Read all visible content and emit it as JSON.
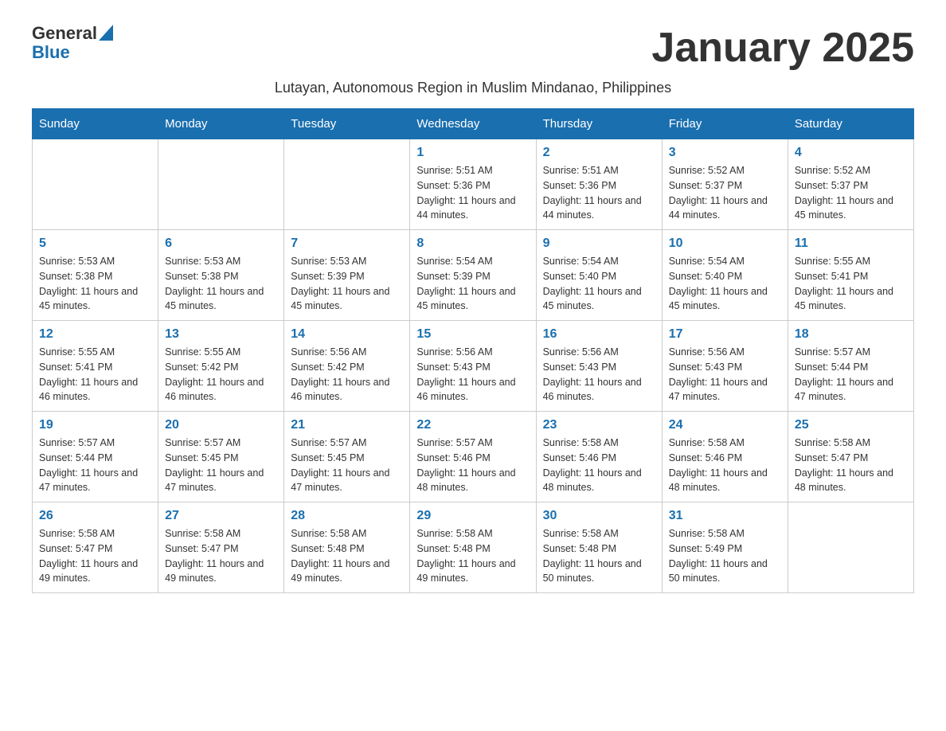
{
  "header": {
    "logo_text_general": "General",
    "logo_text_blue": "Blue",
    "month_title": "January 2025",
    "subtitle": "Lutayan, Autonomous Region in Muslim Mindanao, Philippines"
  },
  "weekdays": [
    "Sunday",
    "Monday",
    "Tuesday",
    "Wednesday",
    "Thursday",
    "Friday",
    "Saturday"
  ],
  "weeks": [
    [
      {
        "day": "",
        "info": ""
      },
      {
        "day": "",
        "info": ""
      },
      {
        "day": "",
        "info": ""
      },
      {
        "day": "1",
        "info": "Sunrise: 5:51 AM\nSunset: 5:36 PM\nDaylight: 11 hours and 44 minutes."
      },
      {
        "day": "2",
        "info": "Sunrise: 5:51 AM\nSunset: 5:36 PM\nDaylight: 11 hours and 44 minutes."
      },
      {
        "day": "3",
        "info": "Sunrise: 5:52 AM\nSunset: 5:37 PM\nDaylight: 11 hours and 44 minutes."
      },
      {
        "day": "4",
        "info": "Sunrise: 5:52 AM\nSunset: 5:37 PM\nDaylight: 11 hours and 45 minutes."
      }
    ],
    [
      {
        "day": "5",
        "info": "Sunrise: 5:53 AM\nSunset: 5:38 PM\nDaylight: 11 hours and 45 minutes."
      },
      {
        "day": "6",
        "info": "Sunrise: 5:53 AM\nSunset: 5:38 PM\nDaylight: 11 hours and 45 minutes."
      },
      {
        "day": "7",
        "info": "Sunrise: 5:53 AM\nSunset: 5:39 PM\nDaylight: 11 hours and 45 minutes."
      },
      {
        "day": "8",
        "info": "Sunrise: 5:54 AM\nSunset: 5:39 PM\nDaylight: 11 hours and 45 minutes."
      },
      {
        "day": "9",
        "info": "Sunrise: 5:54 AM\nSunset: 5:40 PM\nDaylight: 11 hours and 45 minutes."
      },
      {
        "day": "10",
        "info": "Sunrise: 5:54 AM\nSunset: 5:40 PM\nDaylight: 11 hours and 45 minutes."
      },
      {
        "day": "11",
        "info": "Sunrise: 5:55 AM\nSunset: 5:41 PM\nDaylight: 11 hours and 45 minutes."
      }
    ],
    [
      {
        "day": "12",
        "info": "Sunrise: 5:55 AM\nSunset: 5:41 PM\nDaylight: 11 hours and 46 minutes."
      },
      {
        "day": "13",
        "info": "Sunrise: 5:55 AM\nSunset: 5:42 PM\nDaylight: 11 hours and 46 minutes."
      },
      {
        "day": "14",
        "info": "Sunrise: 5:56 AM\nSunset: 5:42 PM\nDaylight: 11 hours and 46 minutes."
      },
      {
        "day": "15",
        "info": "Sunrise: 5:56 AM\nSunset: 5:43 PM\nDaylight: 11 hours and 46 minutes."
      },
      {
        "day": "16",
        "info": "Sunrise: 5:56 AM\nSunset: 5:43 PM\nDaylight: 11 hours and 46 minutes."
      },
      {
        "day": "17",
        "info": "Sunrise: 5:56 AM\nSunset: 5:43 PM\nDaylight: 11 hours and 47 minutes."
      },
      {
        "day": "18",
        "info": "Sunrise: 5:57 AM\nSunset: 5:44 PM\nDaylight: 11 hours and 47 minutes."
      }
    ],
    [
      {
        "day": "19",
        "info": "Sunrise: 5:57 AM\nSunset: 5:44 PM\nDaylight: 11 hours and 47 minutes."
      },
      {
        "day": "20",
        "info": "Sunrise: 5:57 AM\nSunset: 5:45 PM\nDaylight: 11 hours and 47 minutes."
      },
      {
        "day": "21",
        "info": "Sunrise: 5:57 AM\nSunset: 5:45 PM\nDaylight: 11 hours and 47 minutes."
      },
      {
        "day": "22",
        "info": "Sunrise: 5:57 AM\nSunset: 5:46 PM\nDaylight: 11 hours and 48 minutes."
      },
      {
        "day": "23",
        "info": "Sunrise: 5:58 AM\nSunset: 5:46 PM\nDaylight: 11 hours and 48 minutes."
      },
      {
        "day": "24",
        "info": "Sunrise: 5:58 AM\nSunset: 5:46 PM\nDaylight: 11 hours and 48 minutes."
      },
      {
        "day": "25",
        "info": "Sunrise: 5:58 AM\nSunset: 5:47 PM\nDaylight: 11 hours and 48 minutes."
      }
    ],
    [
      {
        "day": "26",
        "info": "Sunrise: 5:58 AM\nSunset: 5:47 PM\nDaylight: 11 hours and 49 minutes."
      },
      {
        "day": "27",
        "info": "Sunrise: 5:58 AM\nSunset: 5:47 PM\nDaylight: 11 hours and 49 minutes."
      },
      {
        "day": "28",
        "info": "Sunrise: 5:58 AM\nSunset: 5:48 PM\nDaylight: 11 hours and 49 minutes."
      },
      {
        "day": "29",
        "info": "Sunrise: 5:58 AM\nSunset: 5:48 PM\nDaylight: 11 hours and 49 minutes."
      },
      {
        "day": "30",
        "info": "Sunrise: 5:58 AM\nSunset: 5:48 PM\nDaylight: 11 hours and 50 minutes."
      },
      {
        "day": "31",
        "info": "Sunrise: 5:58 AM\nSunset: 5:49 PM\nDaylight: 11 hours and 50 minutes."
      },
      {
        "day": "",
        "info": ""
      }
    ]
  ]
}
